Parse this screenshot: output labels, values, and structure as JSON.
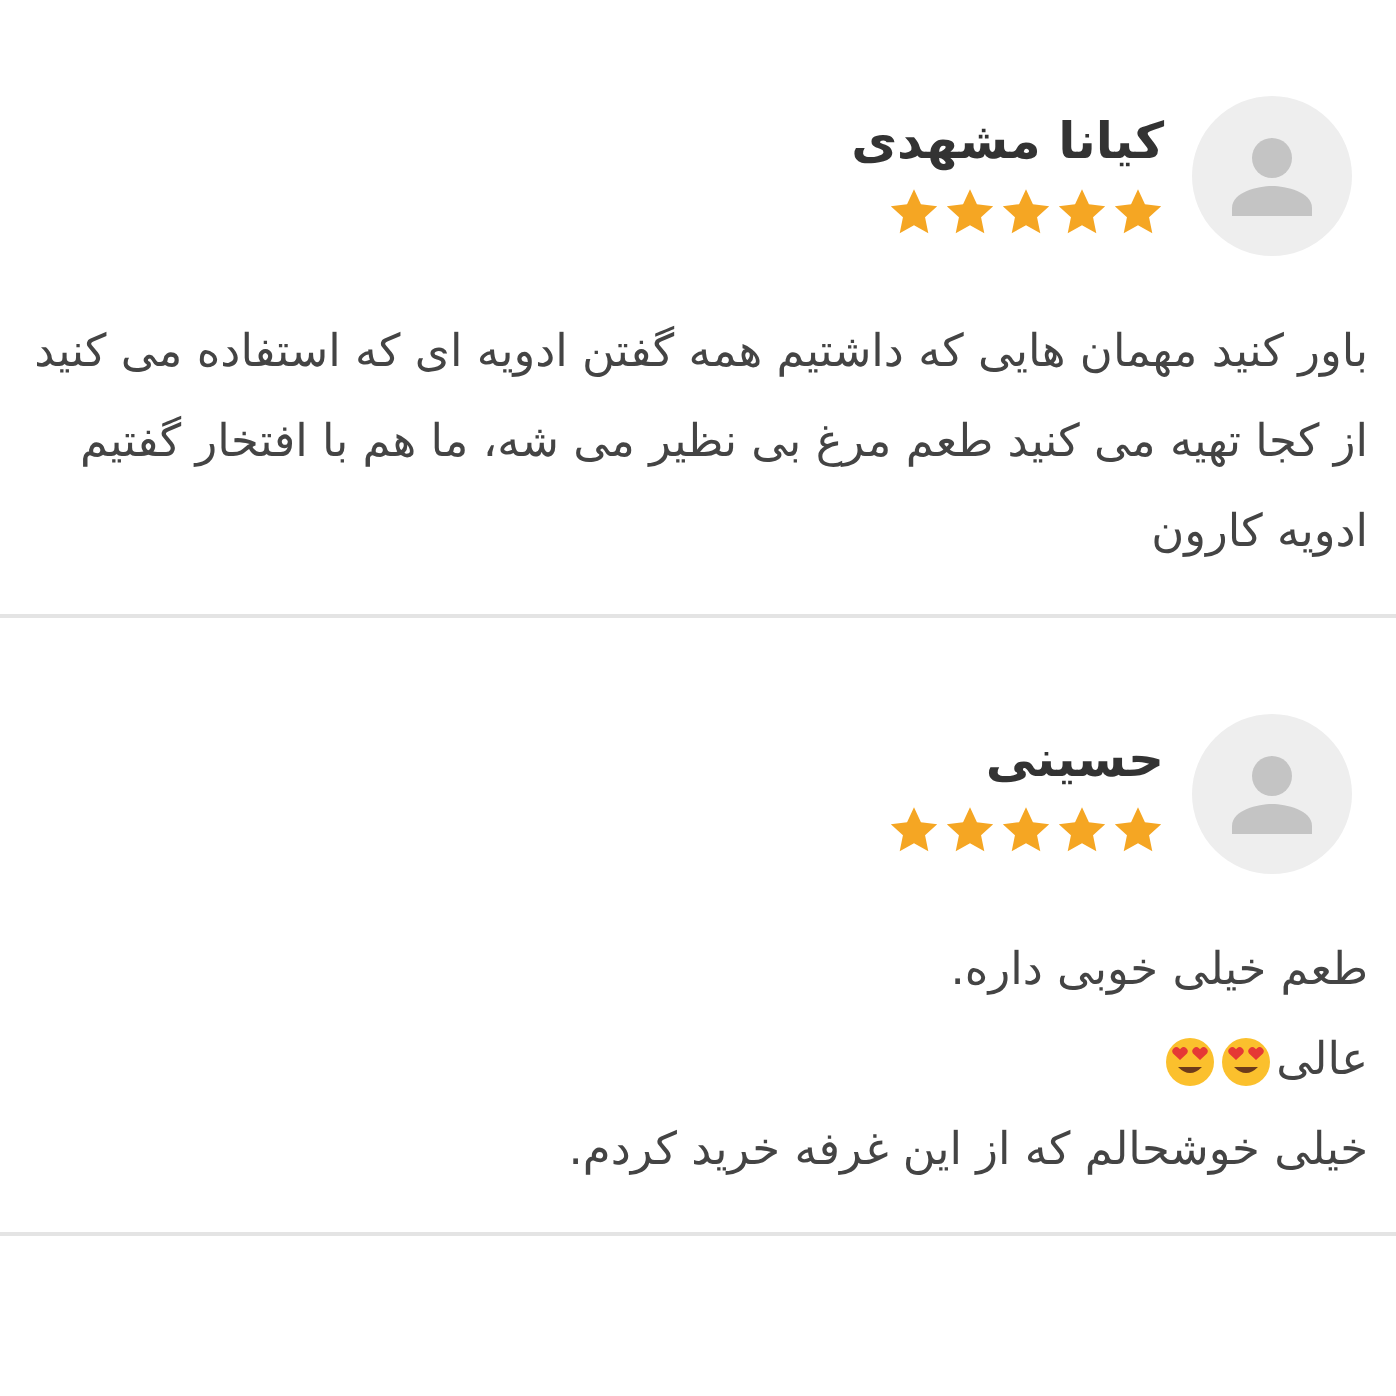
{
  "reviews": [
    {
      "name": "کیانا مشهدی",
      "stars": 5,
      "lines": [
        {
          "text": "باور کنید مهمان هایی که داشتیم همه گفتن ادویه ای که استفاده می کنید از کجا تهیه می کنید طعم مرغ بی نظیر می شه، ما هم با افتخار گفتیم ادویه کارون"
        }
      ]
    },
    {
      "name": "حسینی",
      "stars": 5,
      "lines": [
        {
          "text": "طعم خیلی خوبی داره."
        },
        {
          "text": "عالی",
          "icons": [
            {
              "kind": "heart-eyes"
            },
            {
              "kind": "heart-eyes"
            }
          ]
        },
        {
          "text": "خیلی خوشحالم که از این غرفه خرید کردم."
        }
      ]
    }
  ]
}
